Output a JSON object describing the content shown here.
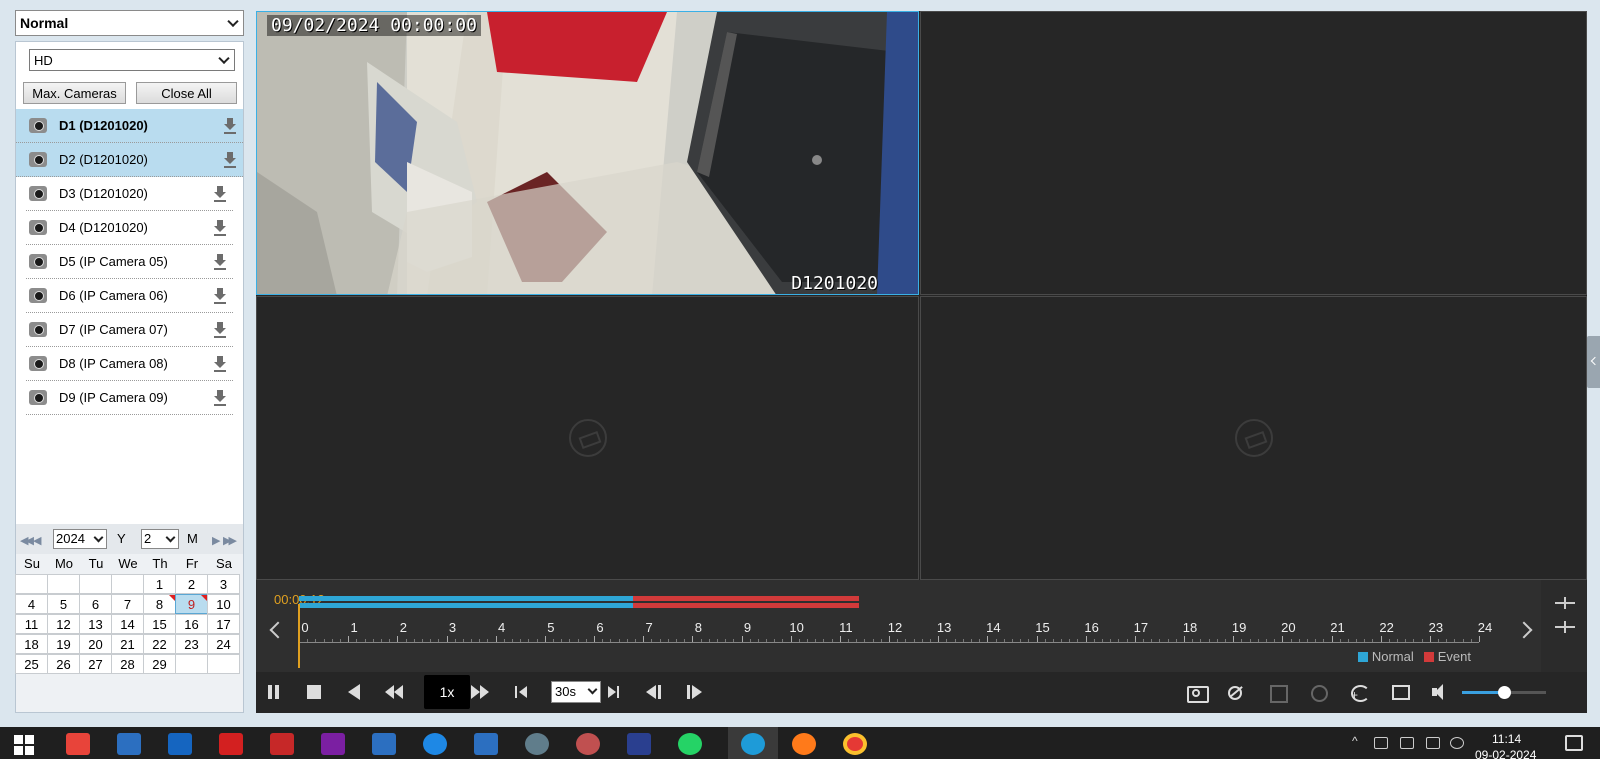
{
  "mode": "Normal",
  "quality": "HD",
  "buttons": {
    "max_cameras": "Max. Cameras",
    "close_all": "Close All"
  },
  "cameras": [
    {
      "label": "D1 (D1201020)",
      "selected": true,
      "bold": true
    },
    {
      "label": "D2 (D1201020)",
      "selected": true,
      "bold": false
    },
    {
      "label": "D3 (D1201020)",
      "selected": false,
      "bold": false
    },
    {
      "label": "D4 (D1201020)",
      "selected": false,
      "bold": false
    },
    {
      "label": "D5 (IP Camera 05)",
      "selected": false,
      "bold": false
    },
    {
      "label": "D6 (IP Camera 06)",
      "selected": false,
      "bold": false
    },
    {
      "label": "D7 (IP Camera 07)",
      "selected": false,
      "bold": false
    },
    {
      "label": "D8 (IP Camera 08)",
      "selected": false,
      "bold": false
    },
    {
      "label": "D9 (IP Camera 09)",
      "selected": false,
      "bold": false
    }
  ],
  "calendar": {
    "year": "2024",
    "year_label": "Y",
    "month": "2",
    "month_label": "M",
    "weekdays": [
      "Su",
      "Mo",
      "Tu",
      "We",
      "Th",
      "Fr",
      "Sa"
    ],
    "weeks": [
      [
        "",
        "",
        "",
        "",
        "1",
        "2",
        "3"
      ],
      [
        "4",
        "5",
        "6",
        "7",
        "8",
        "9",
        "10"
      ],
      [
        "11",
        "12",
        "13",
        "14",
        "15",
        "16",
        "17"
      ],
      [
        "18",
        "19",
        "20",
        "21",
        "22",
        "23",
        "24"
      ],
      [
        "25",
        "26",
        "27",
        "28",
        "29",
        "",
        ""
      ]
    ],
    "recorded_days": [
      "8",
      "9"
    ],
    "selected_day": "9"
  },
  "video": {
    "timestamp": "09/02/2024 00:00:00",
    "camera_name": "D1201020"
  },
  "timeline": {
    "current_time": "00:00:12",
    "hours": [
      "0",
      "1",
      "2",
      "3",
      "4",
      "5",
      "6",
      "7",
      "8",
      "9",
      "10",
      "11",
      "12",
      "13",
      "14",
      "15",
      "16",
      "17",
      "18",
      "19",
      "20",
      "21",
      "22",
      "23",
      "24"
    ],
    "normal_range_hours": [
      0,
      6.8
    ],
    "event_range_hours": [
      6.8,
      11.4
    ],
    "legend_normal": "Normal",
    "legend_event": "Event",
    "colors": {
      "normal": "#2ea6d6",
      "event": "#d23a3a",
      "cursor": "#e0a020"
    }
  },
  "controls": {
    "speed": "1x",
    "skip_interval": "30s",
    "volume": 0.5
  },
  "taskbar": {
    "time": "11:14",
    "date": "09-02-2024"
  }
}
